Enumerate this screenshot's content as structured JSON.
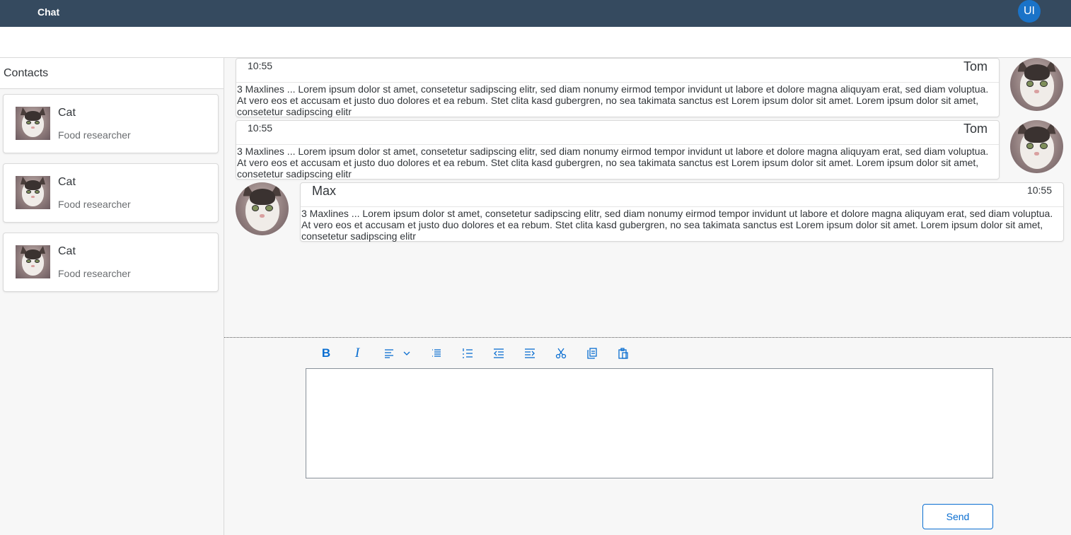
{
  "shell": {
    "title": "Chat",
    "avatar_initials": "UI",
    "avatar_color": "#1a73c8",
    "bar_color": "#354a5f"
  },
  "contacts": {
    "title": "Contacts",
    "items": [
      {
        "name": "Cat",
        "role": "Food researcher"
      },
      {
        "name": "Cat",
        "role": "Food researcher"
      },
      {
        "name": "Cat",
        "role": "Food researcher"
      }
    ]
  },
  "messages": [
    {
      "author": "Tom",
      "time": "10:55",
      "side": "right",
      "text": "3 Maxlines ... Lorem ipsum dolor st amet, consetetur sadipscing elitr, sed diam nonumy eirmod tempor invidunt ut labore et dolore magna aliquyam erat, sed diam voluptua. At vero eos et accusam et justo duo dolores et ea rebum. Stet clita kasd gubergren, no sea takimata sanctus est Lorem ipsum dolor sit amet. Lorem ipsum dolor sit amet, consetetur sadipscing elitr"
    },
    {
      "author": "Tom",
      "time": "10:55",
      "side": "right",
      "text": "3 Maxlines ... Lorem ipsum dolor st amet, consetetur sadipscing elitr, sed diam nonumy eirmod tempor invidunt ut labore et dolore magna aliquyam erat, sed diam voluptua. At vero eos et accusam et justo duo dolores et ea rebum. Stet clita kasd gubergren, no sea takimata sanctus est Lorem ipsum dolor sit amet. Lorem ipsum dolor sit amet, consetetur sadipscing elitr"
    },
    {
      "author": "Max",
      "time": "10:55",
      "side": "left",
      "text": "3 Maxlines ... Lorem ipsum dolor st amet, consetetur sadipscing elitr, sed diam nonumy eirmod tempor invidunt ut labore et dolore magna aliquyam erat, sed diam voluptua. At vero eos et accusam et justo duo dolores et ea rebum. Stet clita kasd gubergren, no sea takimata sanctus est Lorem ipsum dolor sit amet. Lorem ipsum dolor sit amet, consetetur sadipscing elitr"
    }
  ],
  "toolbar": {
    "buttons": [
      "bold-icon",
      "italic-icon",
      "text-align-icon",
      "unordered-list-icon",
      "ordered-list-icon",
      "outdent-icon",
      "indent-icon",
      "cut-icon",
      "copy-icon",
      "paste-icon"
    ],
    "bold_label": "B",
    "italic_label": "I",
    "accent_color": "#0a6ed1"
  },
  "editor": {
    "value": ""
  },
  "send_label": "Send"
}
